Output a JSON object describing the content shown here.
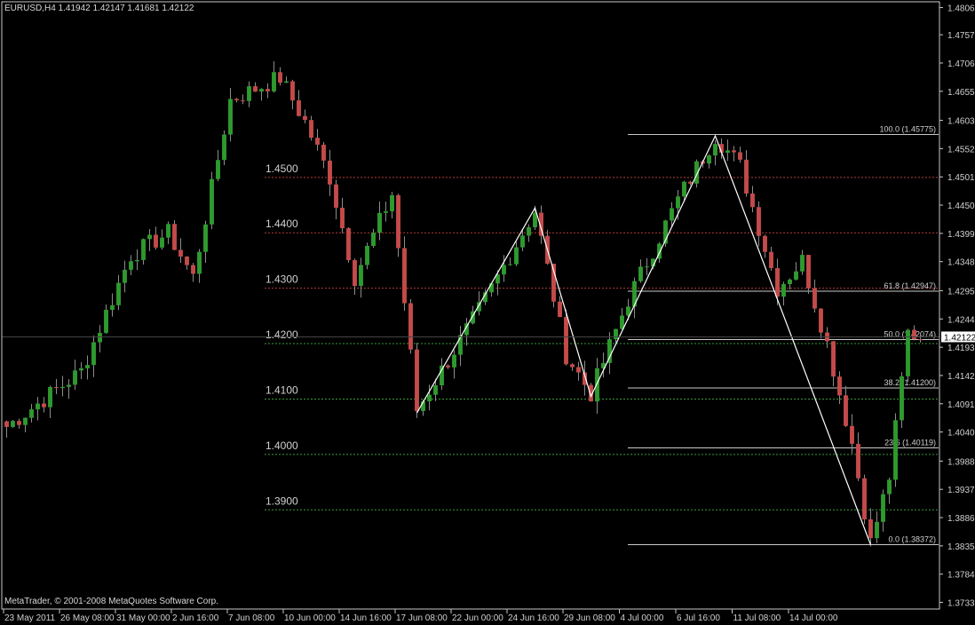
{
  "header": {
    "symbol": "EURUSD,H4",
    "open": "1.41942",
    "high": "1.42147",
    "low": "1.41681",
    "close": "1.42122",
    "title": "EURUSD,H4  1.41942 1.42147 1.41681 1.42122"
  },
  "footer": {
    "copyright": "MetaTrader, © 2001-2008 MetaQuotes Software Corp."
  },
  "colors": {
    "background": "#000000",
    "frame": "#c8c8c8",
    "bull_candle": "#2e9a2e",
    "bear_candle": "#c44a4a",
    "wick": "#8c8c8c",
    "resistance_level": "#b83a3a",
    "support_level": "#3a9a3a",
    "fib_line": "#c8c8c8",
    "zigzag": "#ffffff",
    "axis_text": "#d0d0d0"
  },
  "chart_data": {
    "type": "candlestick",
    "instrument": "EURUSD",
    "timeframe": "H4",
    "current_price": 1.42122,
    "current_price_label": "1.42122",
    "ylim": [
      1.3721,
      1.4817
    ],
    "price_ticks": [
      "1.48065",
      "1.47575",
      "1.47065",
      "1.46555",
      "1.46030",
      "1.45520",
      "1.45010",
      "1.44500",
      "1.43990",
      "1.43480",
      "1.42955",
      "1.42445",
      "1.41935",
      "1.41425",
      "1.40915",
      "1.40405",
      "1.39880",
      "1.39370",
      "1.38860",
      "1.38350",
      "1.37840",
      "1.37330"
    ],
    "time_labels": [
      "23 May 2011",
      "26 May 08:00",
      "31 May 00:00",
      "2 Jun 16:00",
      "7 Jun 08:00",
      "10 Jun 00:00",
      "14 Jun 16:00",
      "17 Jun 08:00",
      "22 Jun 00:00",
      "24 Jun 16:00",
      "29 Jun 08:00",
      "4 Jul 00:00",
      "6 Jul 16:00",
      "11 Jul 08:00",
      "14 Jul 00:00"
    ],
    "horizontal_levels": [
      {
        "price": 1.45,
        "label": "1.4500",
        "kind": "resistance"
      },
      {
        "price": 1.44,
        "label": "1.4400",
        "kind": "resistance"
      },
      {
        "price": 1.43,
        "label": "1.4300",
        "kind": "resistance"
      },
      {
        "price": 1.42,
        "label": "1.4200",
        "kind": "support"
      },
      {
        "price": 1.41,
        "label": "1.4100",
        "kind": "support"
      },
      {
        "price": 1.4,
        "label": "1.4000",
        "kind": "support"
      },
      {
        "price": 1.39,
        "label": "1.3900",
        "kind": "support"
      }
    ],
    "fibonacci": [
      {
        "price": 1.45775,
        "label": "100.0 (1.45775)"
      },
      {
        "price": 1.42947,
        "label": "61.8 (1.42947)"
      },
      {
        "price": 1.42074,
        "label": "50.0 (1.42074)"
      },
      {
        "price": 1.412,
        "label": "38.2 (1.41200)"
      },
      {
        "price": 1.40119,
        "label": "23.6 (1.40119)"
      },
      {
        "price": 1.38372,
        "label": "0.0 (1.38372)"
      }
    ],
    "zigzag": [
      {
        "time_index": 66,
        "price": 1.4075
      },
      {
        "time_index": 85,
        "price": 1.4445
      },
      {
        "time_index": 94,
        "price": 1.4105
      },
      {
        "time_index": 114,
        "price": 1.4575
      },
      {
        "time_index": 139,
        "price": 1.3837
      }
    ],
    "anchors": [
      {
        "t": 0,
        "p": 1.405
      },
      {
        "t": 12,
        "p": 1.415
      },
      {
        "t": 20,
        "p": 1.436
      },
      {
        "t": 26,
        "p": 1.44
      },
      {
        "t": 30,
        "p": 1.432
      },
      {
        "t": 36,
        "p": 1.464
      },
      {
        "t": 42,
        "p": 1.467
      },
      {
        "t": 44,
        "p": 1.468
      },
      {
        "t": 48,
        "p": 1.46
      },
      {
        "t": 52,
        "p": 1.45
      },
      {
        "t": 56,
        "p": 1.432
      },
      {
        "t": 62,
        "p": 1.447
      },
      {
        "t": 66,
        "p": 1.408
      },
      {
        "t": 76,
        "p": 1.426
      },
      {
        "t": 85,
        "p": 1.444
      },
      {
        "t": 90,
        "p": 1.418
      },
      {
        "t": 94,
        "p": 1.411
      },
      {
        "t": 100,
        "p": 1.428
      },
      {
        "t": 108,
        "p": 1.446
      },
      {
        "t": 114,
        "p": 1.4575
      },
      {
        "t": 118,
        "p": 1.452
      },
      {
        "t": 124,
        "p": 1.43
      },
      {
        "t": 128,
        "p": 1.435
      },
      {
        "t": 132,
        "p": 1.42
      },
      {
        "t": 136,
        "p": 1.402
      },
      {
        "t": 139,
        "p": 1.384
      },
      {
        "t": 142,
        "p": 1.396
      },
      {
        "t": 145,
        "p": 1.422
      },
      {
        "t": 147,
        "p": 1.4212
      }
    ]
  }
}
